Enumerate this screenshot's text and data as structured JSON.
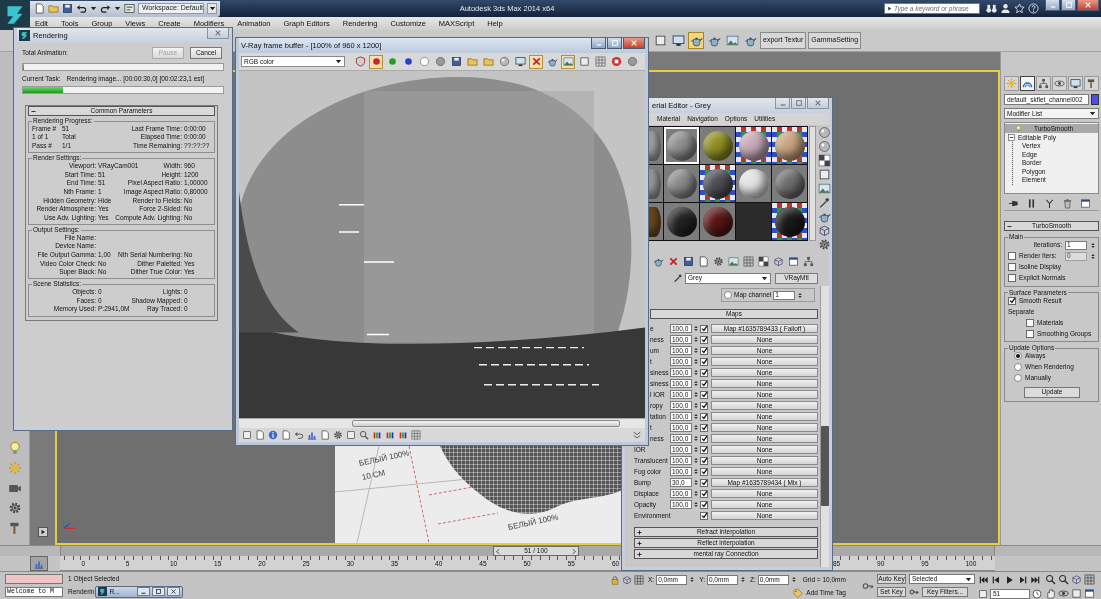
{
  "app": {
    "title": "Autodesk 3ds Max 2014 x64",
    "workspace": "Workspace: Default",
    "search": {
      "placeholder": "Type a keyword or phrase"
    }
  },
  "menu": [
    "Edit",
    "Tools",
    "Group",
    "Views",
    "Create",
    "Modifiers",
    "Animation",
    "Graph Editors",
    "Rendering",
    "Customize",
    "MAXScript",
    "Help"
  ],
  "toolbar": {
    "tools": [
      {
        "selected": false
      },
      {
        "selected": false
      },
      {
        "selected": true
      },
      {
        "selected": false
      },
      {
        "selected": false
      },
      {
        "selected": false
      }
    ],
    "buttons": [
      "export Textur",
      "GammaSetting"
    ]
  },
  "viewport": {
    "labels": [
      "БЕЛЫЙ 100%",
      "10 СМ",
      "БЕЛЫЙ 100%"
    ]
  },
  "rendering_dialog": {
    "title": "Rendering",
    "total_label": "Total Animation:",
    "buttons": [
      {
        "label": "Pause",
        "disabled": true
      },
      {
        "label": "Cancel",
        "disabled": false
      }
    ],
    "total_progress": {
      "level": 0
    },
    "task_label": "Current Task:",
    "task": "Rendering image... [00:00:30,0] [00:02:23,1 est]",
    "task_progress": {
      "level": 0.2
    },
    "rollout": {
      "title": "Common Parameters",
      "expanded": true,
      "groups": [
        {
          "title": "Rendering Progress:",
          "kind": "progress",
          "rows": [
            [
              {
                "label": "Frame #",
                "value": "51"
              },
              {
                "label": "Last Frame Time:",
                "value": "0:00:00"
              }
            ],
            [
              {
                "label": "1 of 1",
                "value": "Total"
              },
              {
                "label": "Elapsed Time:",
                "value": "0:00:00"
              }
            ],
            [
              {
                "label": "Pass #",
                "value": "1/1"
              },
              {
                "label": "Time Remaining:",
                "value": "??:??:??"
              }
            ]
          ]
        },
        {
          "title": "Render Settings:",
          "kind": "settings",
          "rows": [
            [
              {
                "label": "Viewport:",
                "value": "VRayCam001"
              },
              {
                "label": "Width:",
                "value": "960"
              }
            ],
            [
              {
                "label": "Start Time:",
                "value": "51"
              },
              {
                "label": "Height:",
                "value": "1200"
              }
            ],
            [
              {
                "label": "End Time:",
                "value": "51"
              },
              {
                "label": "Pixel Aspect Ratio:",
                "value": "1,00000"
              }
            ],
            [
              {
                "label": "Nth Frame:",
                "value": "1"
              },
              {
                "label": "Image Aspect Ratio:",
                "value": "0,80000"
              }
            ],
            [
              {
                "label": "Hidden Geometry:",
                "value": "Hide"
              },
              {
                "label": "Render to Fields:",
                "value": "No"
              }
            ],
            [
              {
                "label": "Render Atmosphere:",
                "value": "Yes"
              },
              {
                "label": "Force 2-Sided:",
                "value": "No"
              }
            ],
            [
              {
                "label": "Use Adv. Lighting:",
                "value": "Yes"
              },
              {
                "label": "Compute Adv. Lighting:",
                "value": "No"
              }
            ]
          ]
        },
        {
          "title": "Output Settings:",
          "kind": "settings",
          "rows": [
            [
              {
                "label": "File Name:"
              }
            ],
            [
              {
                "label": "Device Name:"
              }
            ],
            [
              {
                "label": "File Output Gamma:",
                "value": "1,00"
              },
              {
                "label": "Nth Serial Numbering:",
                "value": "No"
              }
            ],
            [
              {
                "label": "Video Color Check:",
                "value": "No"
              },
              {
                "label": "Dither Paletted:",
                "value": "Yes"
              }
            ],
            [
              {
                "label": "Super Black:",
                "value": "No"
              },
              {
                "label": "Dither True Color:",
                "value": "Yes"
              }
            ]
          ]
        },
        {
          "title": "Scene Statistics:",
          "kind": "settings",
          "rows": [
            [
              {
                "label": "Objects:",
                "value": "0"
              },
              {
                "label": "Lights:",
                "value": "0"
              }
            ],
            [
              {
                "label": "Faces:",
                "value": "0"
              },
              {
                "label": "Shadow Mapped:",
                "value": "0"
              }
            ],
            [
              {
                "label": "Memory Used:",
                "value": "P:2941,0M"
              },
              {
                "label": "Ray Traced:",
                "value": "0"
              }
            ]
          ]
        }
      ]
    }
  },
  "frame_buffer": {
    "title": "V-Ray frame buffer - [100% of 960 x 1200]",
    "channel": "RGB color",
    "tools": [
      {
        "selected": false
      },
      {
        "selected": true
      },
      {
        "selected": false
      },
      {
        "selected": false
      },
      {
        "selected": false
      },
      {
        "selected": false
      },
      {
        "selected": false
      },
      {
        "selected": false
      },
      {
        "selected": false
      },
      {
        "selected": false
      },
      {
        "selected": false
      },
      {
        "selected": true
      },
      {
        "selected": false
      },
      {
        "selected": true
      },
      {
        "selected": false
      },
      {
        "selected": false
      },
      {
        "selected": false
      },
      {
        "selected": false
      }
    ]
  },
  "material_editor": {
    "title": "erial Editor - Grey",
    "menu": [
      "Material",
      "Navigation",
      "Options",
      "Utilities"
    ],
    "slots": [
      {
        "kind": "plain",
        "color": "#a4a4a4",
        "selected": false
      },
      {
        "kind": "plain",
        "color": "#8e8e8e",
        "selected": true
      },
      {
        "kind": "plain",
        "color": "#8f8f22",
        "selected": false
      },
      {
        "kind": "checker",
        "color": "#c7a9b8",
        "selected": false
      },
      {
        "kind": "checker",
        "color": "#c9a47e",
        "selected": false
      },
      {
        "kind": "plain",
        "color": "#9c9c9c",
        "selected": false
      },
      {
        "kind": "plain",
        "color": "#8a8a8a",
        "selected": false
      },
      {
        "kind": "checker",
        "color": "#4e4e56",
        "selected": false
      },
      {
        "kind": "plain",
        "color": "#e2e2e2",
        "selected": false
      },
      {
        "kind": "plain",
        "color": "#6e6e6e",
        "selected": false
      },
      {
        "kind": "plain",
        "color": "#6b4a22",
        "selected": false
      },
      {
        "kind": "plain",
        "color": "#222222",
        "selected": false
      },
      {
        "kind": "plain",
        "color": "#5a1616",
        "selected": false
      },
      {
        "kind": "empty",
        "selected": false
      },
      {
        "kind": "checker",
        "color": "#1a1a1a",
        "selected": false
      }
    ],
    "material_name": "Grey",
    "material_type": "VRayMtl",
    "map_channel": {
      "label": "Map channel",
      "selected": false,
      "value": "1"
    },
    "maps_title": "Maps",
    "maps": [
      {
        "label": "e",
        "amount": "100,0",
        "enabled": true,
        "map": "Map #1635789433 ( Falloff )"
      },
      {
        "label": "ness",
        "amount": "100,0",
        "enabled": true,
        "map": "None"
      },
      {
        "label": "um",
        "amount": "100,0",
        "enabled": true,
        "map": "None"
      },
      {
        "label": "t",
        "amount": "100,0",
        "enabled": true,
        "map": "None"
      },
      {
        "label": "siness",
        "amount": "100,0",
        "enabled": true,
        "map": "None"
      },
      {
        "label": "siness",
        "amount": "100,0",
        "enabled": true,
        "map": "None"
      },
      {
        "label": "l IOR",
        "amount": "100,0",
        "enabled": true,
        "map": "None"
      },
      {
        "label": "ropy",
        "amount": "100,0",
        "enabled": true,
        "map": "None"
      },
      {
        "label": "tation",
        "amount": "100,0",
        "enabled": true,
        "map": "None"
      },
      {
        "label": "t",
        "amount": "100,0",
        "enabled": true,
        "map": "None"
      },
      {
        "label": "ness",
        "amount": "100,0",
        "enabled": true,
        "map": "None"
      },
      {
        "label": "IOR",
        "amount": "100,0",
        "enabled": true,
        "map": "None"
      },
      {
        "label": "Translucent",
        "amount": "100,0",
        "enabled": true,
        "map": "None"
      },
      {
        "label": "Fog color",
        "amount": "100,0",
        "enabled": true,
        "map": "None"
      },
      {
        "label": "Bump",
        "amount": "30,0",
        "enabled": true,
        "map": "Map #1635789434 ( Mix )"
      },
      {
        "label": "Displace",
        "amount": "100,0",
        "enabled": true,
        "map": "None"
      },
      {
        "label": "Opacity",
        "amount": "100,0",
        "enabled": true,
        "map": "None"
      },
      {
        "label": "Environment",
        "enabled": true,
        "map": "None"
      }
    ],
    "rollouts": [
      {
        "title": "Refract interpolation",
        "expanded": false
      },
      {
        "title": "Reflect interpolation",
        "expanded": false
      },
      {
        "title": "mental ray Connection",
        "expanded": false
      }
    ]
  },
  "command_panel": {
    "tabs": [
      {
        "selected": false
      },
      {
        "selected": true
      },
      {
        "selected": false
      },
      {
        "selected": false
      },
      {
        "selected": false
      },
      {
        "selected": false
      }
    ],
    "object_name": "default_skflet_channel002",
    "modifier_list": "Modifier List",
    "stack": [
      {
        "kind": "modifier",
        "label": "TurboSmooth",
        "on": true,
        "selected": true
      },
      {
        "kind": "object",
        "label": "Editable Poly",
        "expanded": true,
        "selected": false,
        "children": [
          {
            "label": "Vertex",
            "selected": false
          },
          {
            "label": "Edge",
            "selected": false
          },
          {
            "label": "Border",
            "selected": false
          },
          {
            "label": "Polygon",
            "selected": false
          },
          {
            "label": "Element",
            "selected": false
          }
        ]
      }
    ],
    "turbosmooth": {
      "title": "TurboSmooth",
      "expanded": true,
      "main": {
        "title": "Main",
        "iterations": {
          "label": "Iterations:",
          "value": "1"
        },
        "render_iters": {
          "label": "Render Iters:",
          "value": "0",
          "checked": false,
          "disabled": true
        },
        "options": [
          {
            "label": "Isoline Display",
            "checked": false
          },
          {
            "label": "Explicit Normals",
            "checked": false
          }
        ]
      },
      "surface": {
        "title": "Surface Parameters",
        "smooth_result": {
          "label": "Smooth Result",
          "checked": true
        },
        "separate_label": "Separate",
        "separate": [
          {
            "label": "Materials",
            "checked": false
          },
          {
            "label": "Smoothing Groups",
            "checked": false
          }
        ]
      },
      "update": {
        "title": "Update Options",
        "modes": [
          {
            "label": "Always",
            "selected": true
          },
          {
            "label": "When Rendering",
            "selected": false
          },
          {
            "label": "Manually",
            "selected": false
          }
        ],
        "button": "Update"
      }
    }
  },
  "timeline": {
    "position": "51 / 100",
    "level": 0.51,
    "ticks_start": [
      "0",
      "5",
      "10",
      "15",
      "20",
      "25",
      "30",
      "35",
      "40",
      "45",
      "50",
      "55",
      "60"
    ],
    "ticks_end": [
      "85",
      "90",
      "95",
      "100"
    ]
  },
  "status": {
    "listener_output": "Welcome to M",
    "selection": "1 Object Selected",
    "prompt": "Renderin",
    "minimized_window": "R...",
    "coordinates": [
      {
        "axis": "X:",
        "value": "0,0mm"
      },
      {
        "axis": "Y:",
        "value": "0,0mm"
      },
      {
        "axis": "Z:",
        "value": "0,0mm"
      }
    ],
    "grid": "Grid = 10,0mm",
    "time_tag": "Add Time Tag",
    "auto_key": {
      "label": "Auto Key",
      "on": false
    },
    "key_mode": "Selected",
    "set_key": "Set Key",
    "key_filters": "Key Filters...",
    "frame": "51"
  }
}
